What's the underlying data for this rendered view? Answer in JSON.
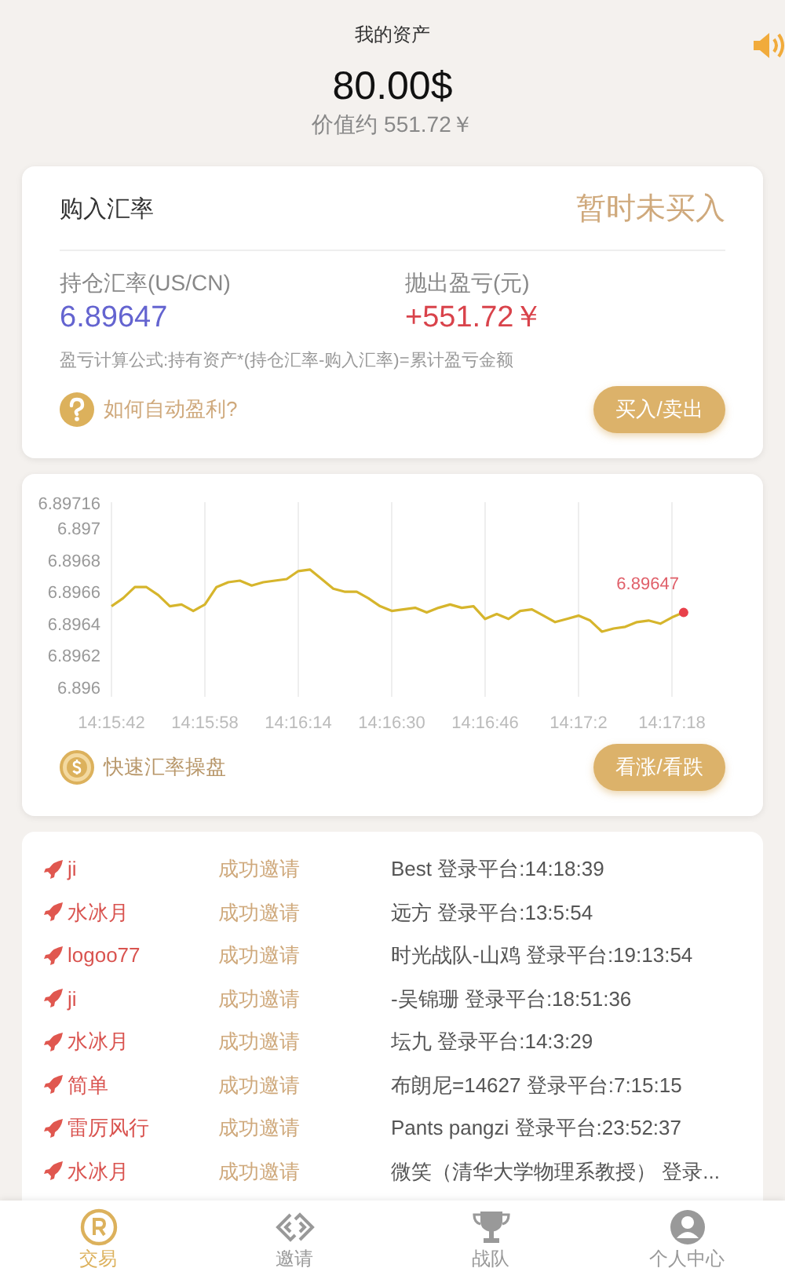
{
  "header": {
    "title": "我的资产",
    "balance": "80.00$",
    "worth": "价值约 551.72￥"
  },
  "rate_card": {
    "title": "购入汇率",
    "status": "暂时未买入",
    "hold_label": "持仓汇率(US/CN)",
    "hold_value": "6.89647",
    "profit_label": "抛出盈亏(元)",
    "profit_value": "+551.72￥",
    "formula": "盈亏计算公式:持有资产*(持仓汇率-购入汇率)=累计盈亏金额",
    "help_link": "如何自动盈利?",
    "action_button": "买入/卖出"
  },
  "chart_card": {
    "chart_data": {
      "type": "line",
      "categories": [
        "14:15:42",
        null,
        null,
        null,
        null,
        null,
        null,
        null,
        "14:15:58",
        null,
        null,
        null,
        null,
        null,
        null,
        null,
        "14:16:14",
        null,
        null,
        null,
        null,
        null,
        null,
        null,
        "14:16:30",
        null,
        null,
        null,
        null,
        null,
        null,
        null,
        "14:16:46",
        null,
        null,
        null,
        null,
        null,
        null,
        null,
        "14:17:2",
        null,
        null,
        null,
        null,
        null,
        null,
        null,
        "14:17:18",
        null
      ],
      "series": [
        {
          "color": "#d6b52c",
          "values": [
            6.89651,
            6.89656,
            6.89663,
            6.89663,
            6.89658,
            6.89651,
            6.89652,
            6.89648,
            6.89652,
            6.89663,
            6.89666,
            6.89667,
            6.89664,
            6.89666,
            6.89667,
            6.89668,
            6.89673,
            6.89674,
            6.89668,
            6.89662,
            6.8966,
            6.8966,
            6.89656,
            6.89651,
            6.89648,
            6.89649,
            6.8965,
            6.89647,
            6.8965,
            6.89652,
            6.8965,
            6.89651,
            6.89643,
            6.89646,
            6.89643,
            6.89648,
            6.89649,
            6.89645,
            6.89641,
            6.89643,
            6.89645,
            6.89642,
            6.89635,
            6.89637,
            6.89638,
            6.89641,
            6.89642,
            6.8964,
            6.89644,
            6.89647
          ]
        }
      ],
      "ylim": [
        6.896,
        6.89716
      ],
      "yticks": [
        6.896,
        6.8962,
        6.8964,
        6.8966,
        6.8968,
        6.897,
        6.89716
      ],
      "grid": true,
      "annotations": [
        {
          "y": 6.89647,
          "text": "6.89647"
        }
      ]
    },
    "quick_link": "快速汇率操盘",
    "action_button": "看涨/看跌"
  },
  "invites": [
    {
      "name": "ji",
      "status": "成功邀请",
      "detail": "Best 登录平台:14:18:39"
    },
    {
      "name": "水冰月",
      "status": "成功邀请",
      "detail": "远方 登录平台:13:5:54"
    },
    {
      "name": "logoo77",
      "status": "成功邀请",
      "detail": "时光战队-山鸡 登录平台:19:13:54"
    },
    {
      "name": "ji",
      "status": "成功邀请",
      "detail": "-吴锦珊 登录平台:18:51:36"
    },
    {
      "name": "水冰月",
      "status": "成功邀请",
      "detail": "坛九 登录平台:14:3:29"
    },
    {
      "name": "简单",
      "status": "成功邀请",
      "detail": "布朗尼=14627 登录平台:7:15:15"
    },
    {
      "name": "雷厉风行",
      "status": "成功邀请",
      "detail": "Pants pangzi 登录平台:23:52:37"
    },
    {
      "name": "水冰月",
      "status": "成功邀请",
      "detail": "微笑（清华大学物理系教授） 登录..."
    }
  ],
  "tab_bar": [
    {
      "label": "交易",
      "selected": true
    },
    {
      "label": "邀请",
      "selected": false
    },
    {
      "label": "战队",
      "selected": false
    },
    {
      "label": "个人中心",
      "selected": false
    }
  ]
}
